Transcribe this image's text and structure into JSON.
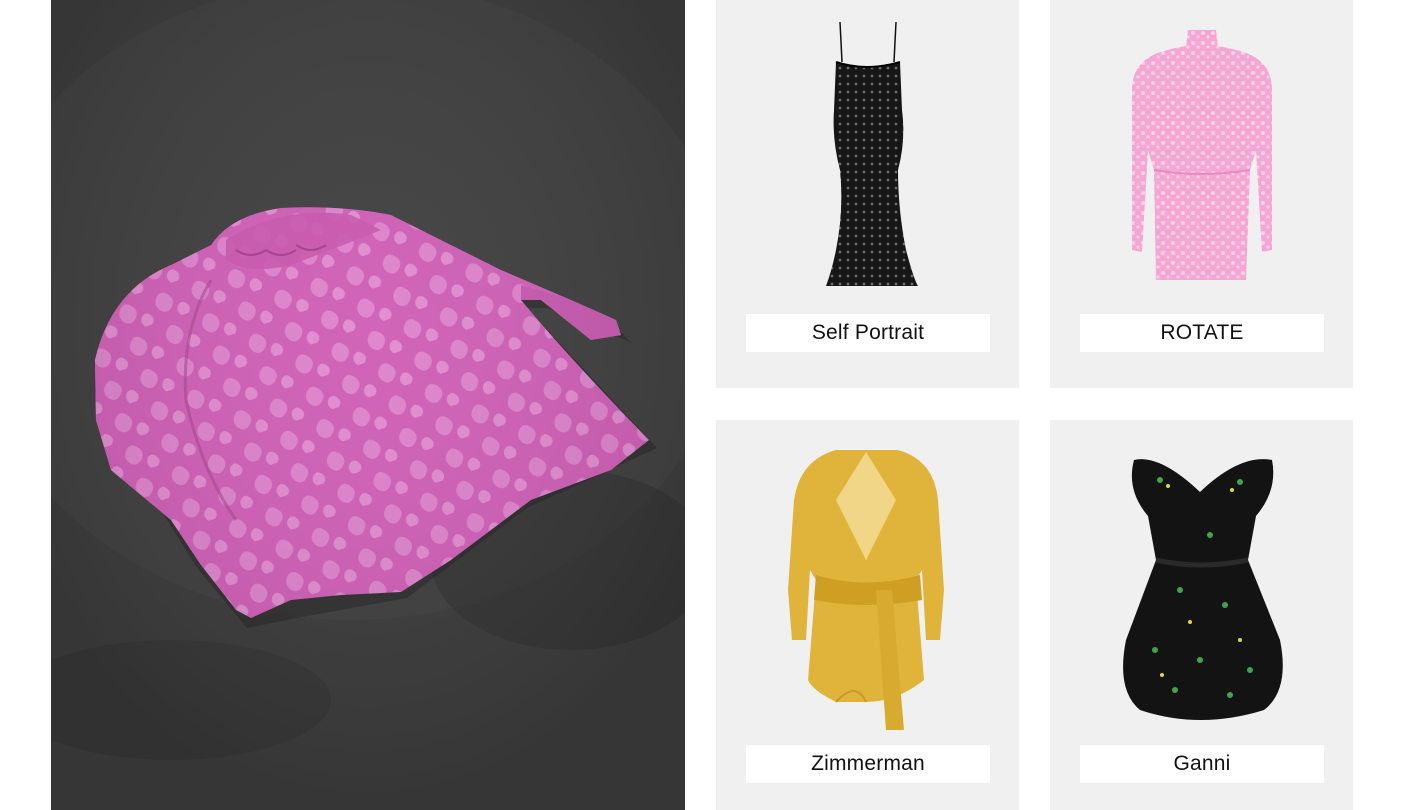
{
  "hero": {
    "image": "pink-jacquard-dress-on-concrete-floor",
    "colors": {
      "floor": "#3a3a3a",
      "dress": "#d165b8",
      "dress_pattern": "#e28fd0"
    }
  },
  "products": [
    {
      "brand": "Self Portrait",
      "image": "black-beaded-midi-slip-dress",
      "color": "#1a1a1a"
    },
    {
      "brand": "ROTATE",
      "image": "pink-puff-sleeve-mini-dress",
      "color": "#f4a9d4"
    },
    {
      "brand": "Zimmerman",
      "image": "yellow-silk-wrap-mini-dress",
      "color": "#e3b43a"
    },
    {
      "brand": "Ganni",
      "image": "black-floral-ruffle-tulle-dress",
      "color": "#151515"
    }
  ]
}
